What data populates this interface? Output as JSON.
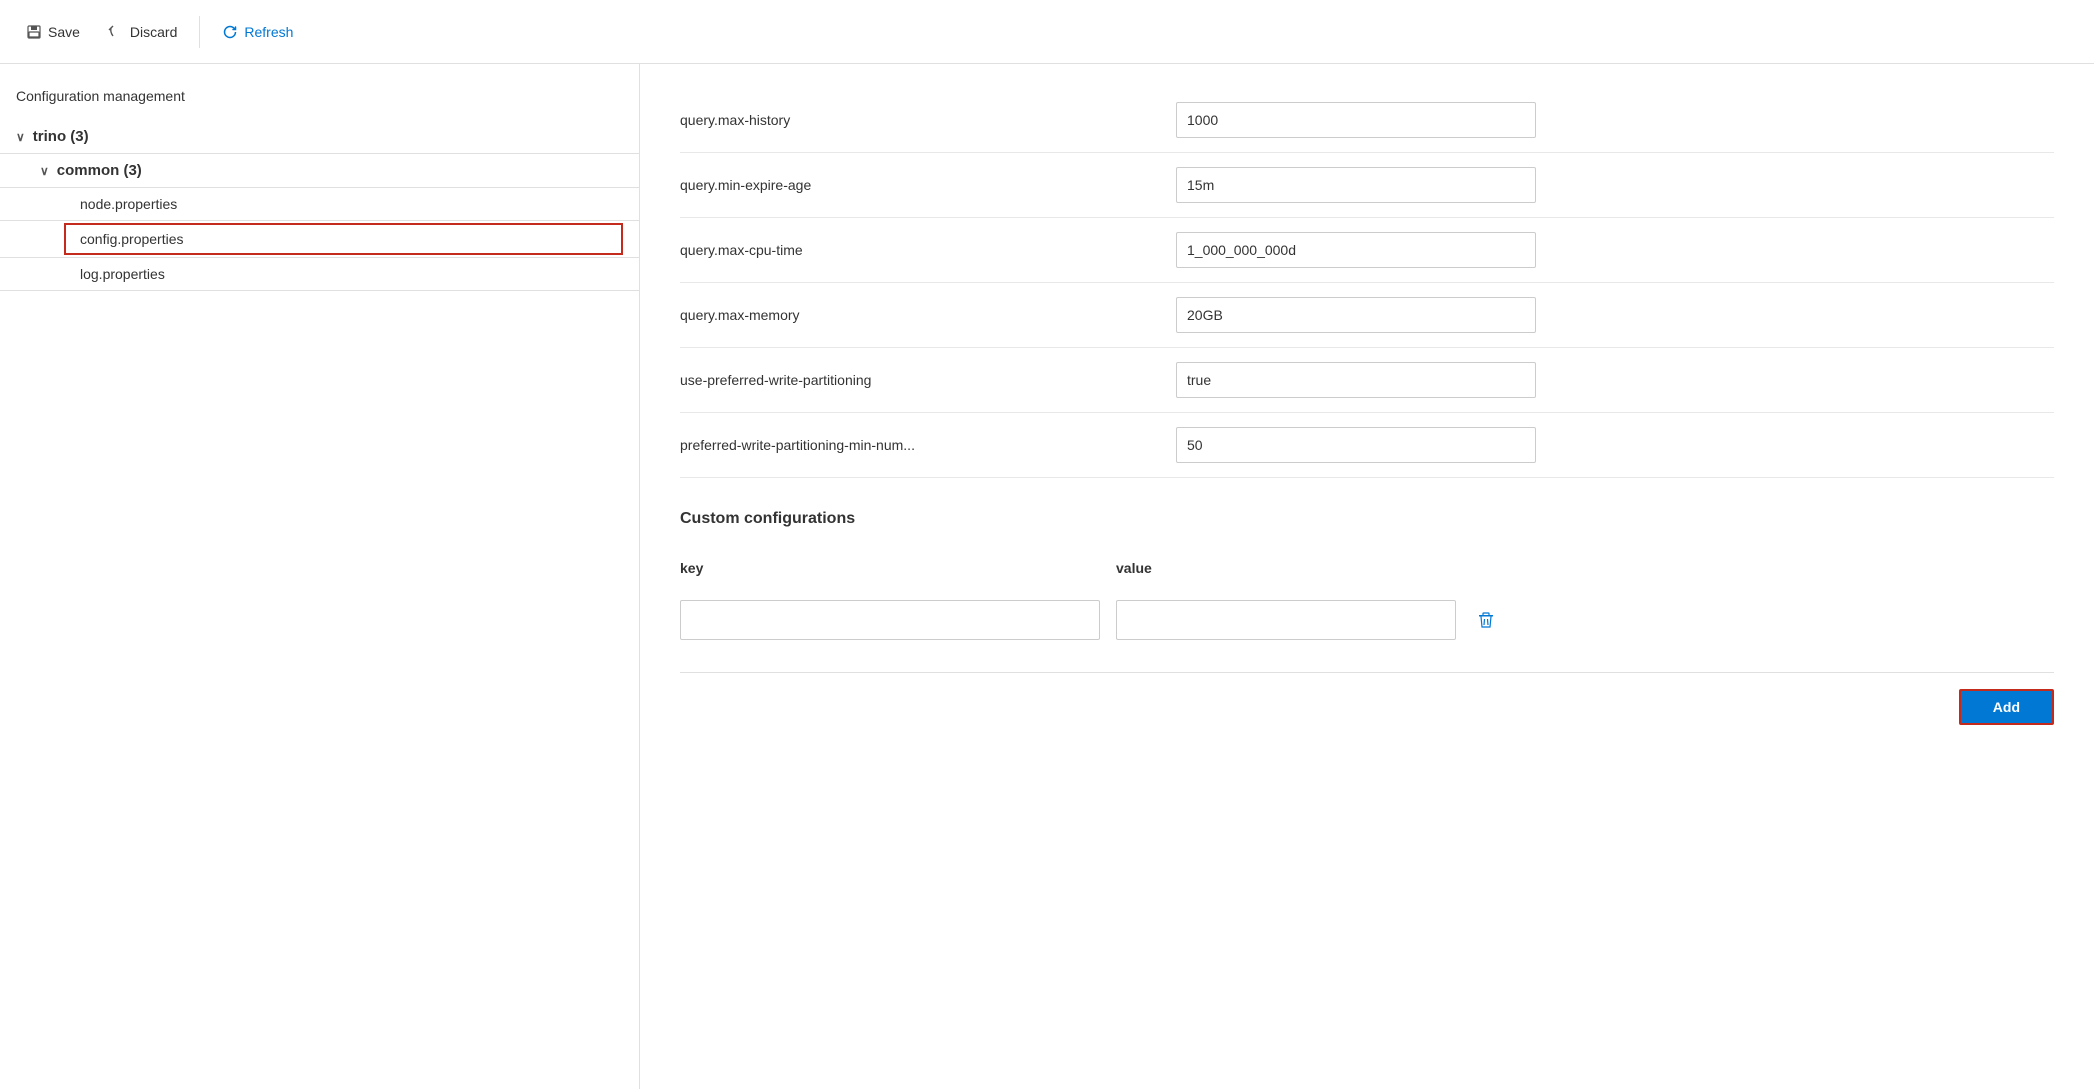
{
  "toolbar": {
    "save_label": "Save",
    "discard_label": "Discard",
    "refresh_label": "Refresh"
  },
  "sidebar": {
    "title": "Configuration management",
    "tree": [
      {
        "id": "trino",
        "label": "trino (3)",
        "level": 0,
        "expanded": true
      },
      {
        "id": "common",
        "label": "common (3)",
        "level": 1,
        "expanded": true
      },
      {
        "id": "node-properties",
        "label": "node.properties",
        "level": 2,
        "selected": false
      },
      {
        "id": "config-properties",
        "label": "config.properties",
        "level": 2,
        "selected": true
      },
      {
        "id": "log-properties",
        "label": "log.properties",
        "level": 2,
        "selected": false
      }
    ]
  },
  "config_rows": [
    {
      "key": "query.max-history",
      "value": "1000"
    },
    {
      "key": "query.min-expire-age",
      "value": "15m"
    },
    {
      "key": "query.max-cpu-time",
      "value": "1_000_000_000d"
    },
    {
      "key": "query.max-memory",
      "value": "20GB"
    },
    {
      "key": "use-preferred-write-partitioning",
      "value": "true"
    },
    {
      "key": "preferred-write-partitioning-min-num...",
      "value": "50"
    }
  ],
  "custom_section": {
    "title": "Custom configurations",
    "col_key": "key",
    "col_value": "value",
    "row_key_placeholder": "",
    "row_value_placeholder": ""
  },
  "add_button": {
    "label": "Add"
  }
}
